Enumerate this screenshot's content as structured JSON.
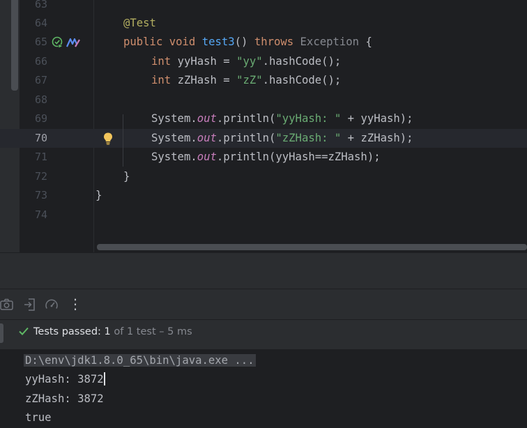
{
  "editor": {
    "lines": [
      {
        "num": "63"
      },
      {
        "num": "64",
        "annotation": "@Test"
      },
      {
        "num": "65",
        "kw1": "public",
        "kw2": "void",
        "method": "test3",
        "paren": "()",
        "throws": "throws",
        "exception": "Exception",
        "brace": "{"
      },
      {
        "num": "66",
        "type": "int",
        "var": "yyHash",
        "eq": "=",
        "str": "\"yy\"",
        "call": ".hashCode();"
      },
      {
        "num": "67",
        "type": "int",
        "var": "zZHash",
        "eq": "=",
        "str": "\"zZ\"",
        "call": ".hashCode();"
      },
      {
        "num": "68"
      },
      {
        "num": "69",
        "sys": "System.",
        "field": "out",
        "println": ".println(",
        "str": "\"yyHash: \"",
        "rest": " + yyHash);"
      },
      {
        "num": "70",
        "sys": "System.",
        "field": "out",
        "println": ".println(",
        "str": "\"zZHash: \"",
        "rest": " + zZHash);"
      },
      {
        "num": "71",
        "sys": "System.",
        "field": "out",
        "rest": ".println(yyHash==zZHash);"
      },
      {
        "num": "72",
        "brace": "}"
      },
      {
        "num": "73",
        "brace": "}"
      },
      {
        "num": "74"
      }
    ],
    "current_line": "70"
  },
  "toolbar": {
    "icons": [
      "camera-icon",
      "import-icon",
      "gauge-icon",
      "more-icon"
    ],
    "more_glyph": "⋮"
  },
  "test_status": {
    "label": "Tests passed: ",
    "count": "1",
    "rest": " of 1 test – 5 ms",
    "color": "#5fb865"
  },
  "console": {
    "command": "D:\\env\\jdk1.8.0_65\\bin\\java.exe ...",
    "out1": "yyHash: 3872",
    "out2": "zZHash: 3872",
    "out3": "true"
  },
  "colors": {
    "keyword": "#cf8e6d",
    "string": "#6aab73",
    "method": "#56a8f5",
    "annotation": "#b3ae60",
    "field": "#c77dbb"
  }
}
